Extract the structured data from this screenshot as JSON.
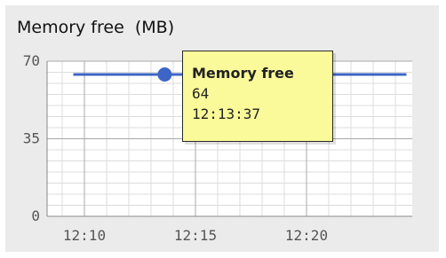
{
  "chart_data": {
    "type": "line",
    "title": "Memory free  (MB)",
    "x_ticks": [
      "12:10",
      "12:15",
      "12:20"
    ],
    "y_ticks": [
      0,
      35,
      70
    ],
    "ylim": [
      0,
      70
    ],
    "grid": true,
    "series": [
      {
        "name": "Memory free",
        "color": "#3d65c5",
        "x": [
          "12:09:30",
          "12:13:37",
          "12:24:30"
        ],
        "values": [
          64,
          64,
          64
        ]
      }
    ],
    "highlight": {
      "title": "Memory free",
      "value": "64",
      "time": "12:13:37"
    }
  }
}
